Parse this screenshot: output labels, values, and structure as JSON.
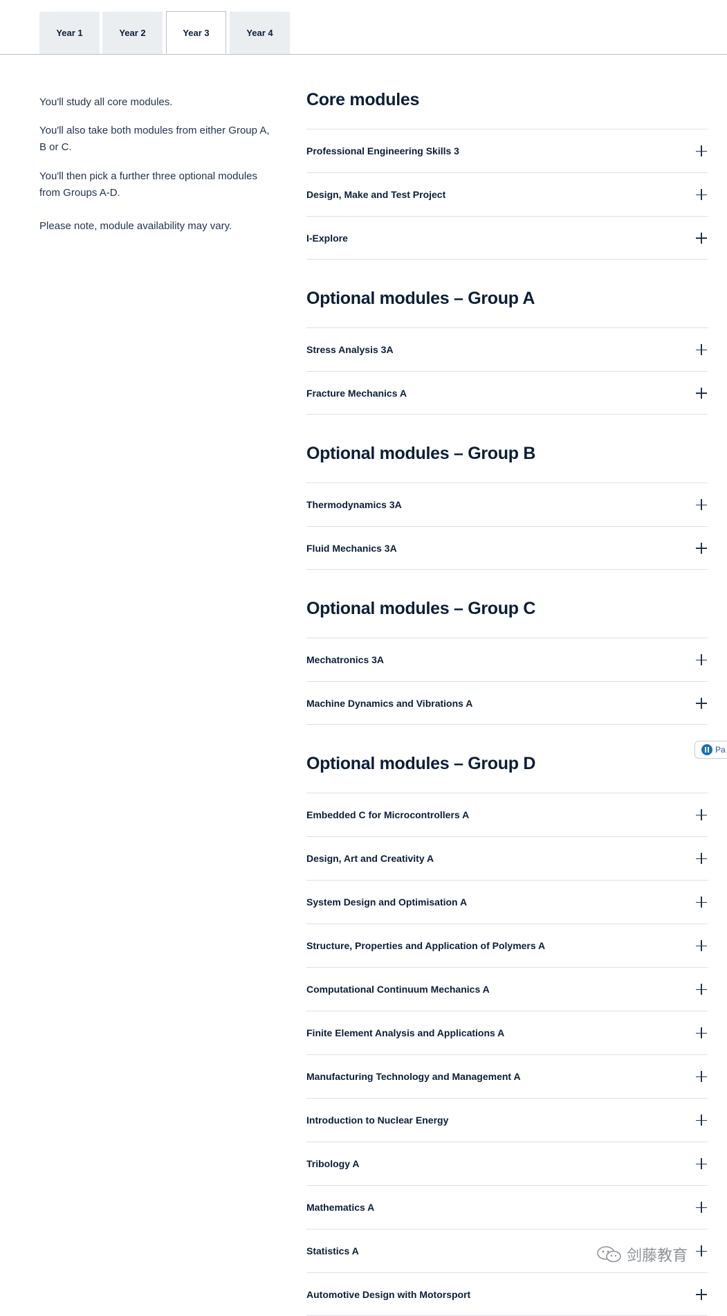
{
  "tabs": [
    {
      "label": "Year 1",
      "active": false
    },
    {
      "label": "Year 2",
      "active": false
    },
    {
      "label": "Year 3",
      "active": true
    },
    {
      "label": "Year 4",
      "active": false
    }
  ],
  "intro": {
    "p1": "You'll study all core modules.",
    "p2": "You'll also take both modules from either Group A, B or C.",
    "p3": "You'll then pick a further three optional modules from Groups A-D.",
    "p4": "Please note, module availability may vary."
  },
  "sections": [
    {
      "title": "Core modules",
      "modules": [
        "Professional Engineering Skills 3",
        "Design, Make and Test Project",
        "I-Explore"
      ]
    },
    {
      "title": "Optional modules – Group A",
      "modules": [
        "Stress Analysis 3A",
        "Fracture Mechanics A"
      ]
    },
    {
      "title": "Optional modules – Group B",
      "modules": [
        "Thermodynamics 3A",
        "Fluid Mechanics 3A"
      ]
    },
    {
      "title": "Optional modules – Group C",
      "modules": [
        "Mechatronics 3A",
        "Machine Dynamics and Vibrations A"
      ]
    },
    {
      "title": "Optional modules – Group D",
      "modules": [
        "Embedded C for Microcontrollers A",
        "Design, Art and Creativity A",
        "System Design and Optimisation A",
        "Structure, Properties and Application of Polymers A",
        "Computational Continuum Mechanics A",
        "Finite Element Analysis and Applications A",
        "Manufacturing Technology and Management A",
        "Introduction to Nuclear Energy",
        "Tribology A",
        "Mathematics A",
        "Statistics A",
        "Automotive Design with Motorsport"
      ]
    }
  ],
  "side_badge": {
    "label": "Pa",
    "icon": "pause-icon"
  },
  "watermark": {
    "text": "剑藤教育",
    "icon": "wechat-icon"
  }
}
